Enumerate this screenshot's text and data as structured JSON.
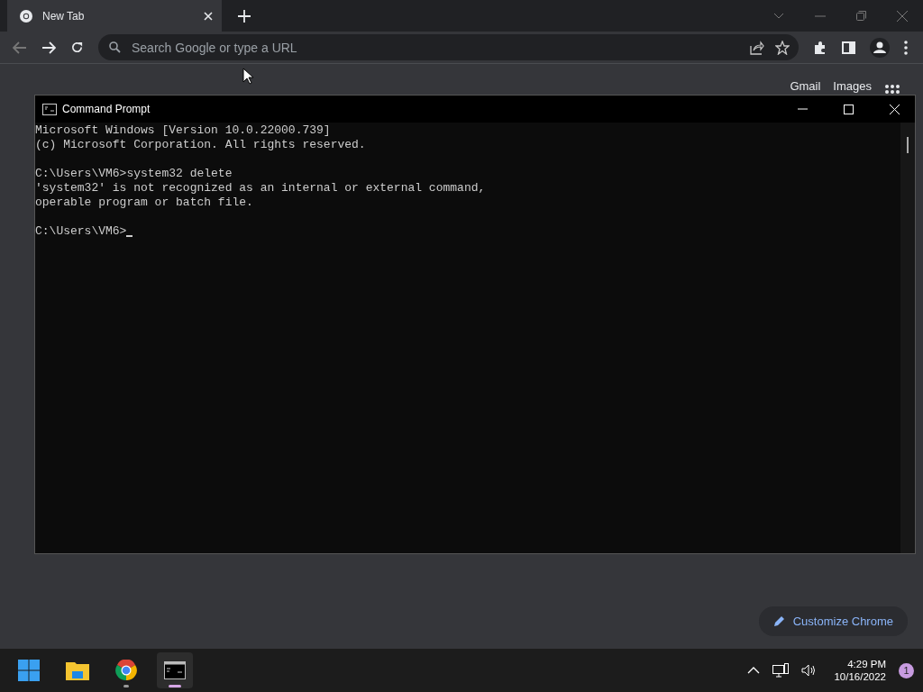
{
  "browser": {
    "tabs": [
      {
        "label": "New Tab",
        "selected": true
      }
    ],
    "address_bar": {
      "placeholder": "Search Google or type a URL"
    },
    "links": [
      "Gmail",
      "Images"
    ],
    "customize_button": "Customize Chrome"
  },
  "cmd_window": {
    "title": "Command Prompt",
    "blocks": [
      [
        "Microsoft Windows [Version 10.0.22000.739]",
        "(c) Microsoft Corporation. All rights reserved."
      ],
      [
        "C:\\Users\\VM6>system32 delete",
        "'system32' is not recognized as an internal or external command,",
        "operable program or batch file."
      ],
      [
        "C:\\Users\\VM6>"
      ]
    ]
  },
  "taskbar": {
    "apps": [
      {
        "kind": "start",
        "running": false,
        "selected": false
      },
      {
        "kind": "explorer",
        "running": false,
        "selected": false
      },
      {
        "kind": "chrome",
        "running": true,
        "selected": false
      },
      {
        "kind": "terminal",
        "running": true,
        "selected": true
      }
    ],
    "time": "4:29 PM",
    "date": "10/16/2022",
    "notifications": "1"
  }
}
